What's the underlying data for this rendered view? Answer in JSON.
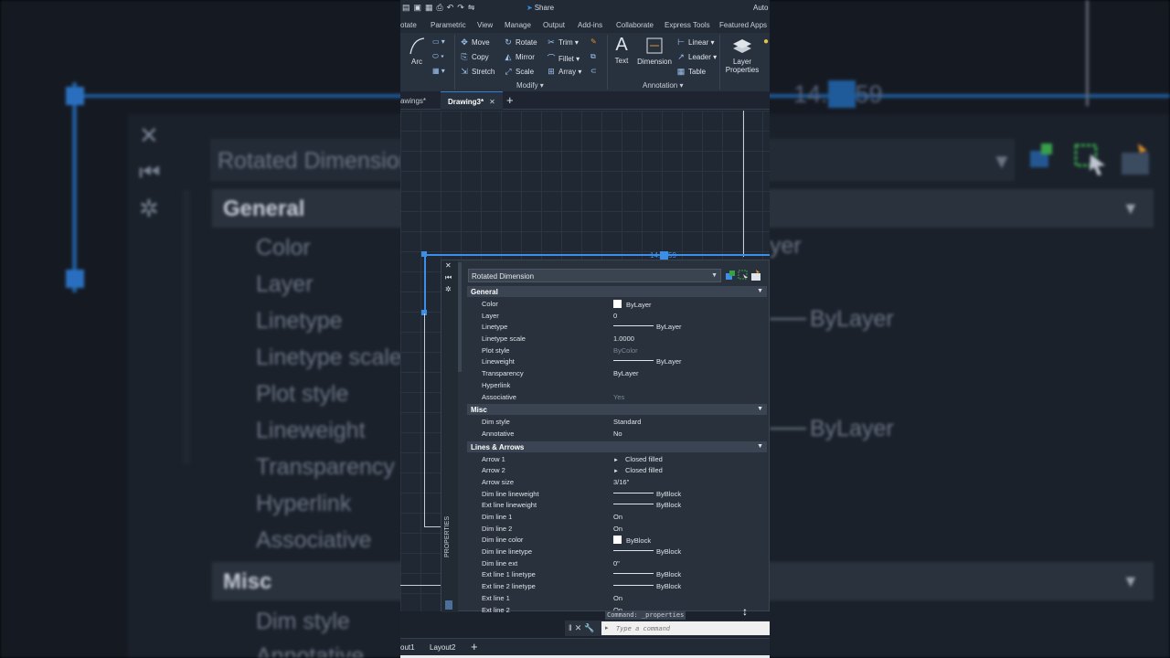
{
  "window": {
    "app_name": "Auto",
    "share_label": "Share"
  },
  "ribbon": {
    "tabs": [
      "otate",
      "Parametric",
      "View",
      "Manage",
      "Output",
      "Add-ins",
      "Collaborate",
      "Express Tools",
      "Featured Apps"
    ],
    "draw": {
      "arc_label": "Arc"
    },
    "modify": {
      "title": "Modify",
      "move": "Move",
      "rotate": "Rotate",
      "trim": "Trim",
      "copy": "Copy",
      "mirror": "Mirror",
      "fillet": "Fillet",
      "stretch": "Stretch",
      "scale": "Scale",
      "array": "Array"
    },
    "annotation": {
      "title": "Annotation",
      "text": "Text",
      "dimension": "Dimension",
      "linear": "Linear",
      "leader": "Leader",
      "table": "Table"
    },
    "layers": {
      "layer_properties_line1": "Layer",
      "layer_properties_line2": "Properties"
    }
  },
  "doc_tabs": {
    "prev": "awings*",
    "active": "Drawing3*"
  },
  "drawing": {
    "dimension_text_left": "14.",
    "dimension_text_right": "59"
  },
  "properties": {
    "palette_label": "PROPERTIES",
    "object_type": "Rotated Dimension",
    "sections": [
      {
        "title": "General",
        "rows": [
          {
            "key": "Color",
            "value": "ByLayer",
            "kind": "swatch"
          },
          {
            "key": "Layer",
            "value": "0",
            "kind": "text"
          },
          {
            "key": "Linetype",
            "value": "ByLayer",
            "kind": "line"
          },
          {
            "key": "Linetype scale",
            "value": "1.0000",
            "kind": "text"
          },
          {
            "key": "Plot style",
            "value": "ByColor",
            "kind": "dim"
          },
          {
            "key": "Lineweight",
            "value": "ByLayer",
            "kind": "line"
          },
          {
            "key": "Transparency",
            "value": "ByLayer",
            "kind": "text"
          },
          {
            "key": "Hyperlink",
            "value": "",
            "kind": "text"
          },
          {
            "key": "Associative",
            "value": "Yes",
            "kind": "dim"
          }
        ]
      },
      {
        "title": "Misc",
        "rows": [
          {
            "key": "Dim style",
            "value": "Standard",
            "kind": "text"
          },
          {
            "key": "Annotative",
            "value": "No",
            "kind": "text"
          }
        ]
      },
      {
        "title": "Lines & Arrows",
        "rows": [
          {
            "key": "Arrow 1",
            "value": "Closed filled",
            "kind": "arrow"
          },
          {
            "key": "Arrow 2",
            "value": "Closed filled",
            "kind": "arrow"
          },
          {
            "key": "Arrow size",
            "value": "3/16\"",
            "kind": "text"
          },
          {
            "key": "Dim line lineweight",
            "value": "ByBlock",
            "kind": "line"
          },
          {
            "key": "Ext line lineweight",
            "value": "ByBlock",
            "kind": "line"
          },
          {
            "key": "Dim line 1",
            "value": "On",
            "kind": "text"
          },
          {
            "key": "Dim line 2",
            "value": "On",
            "kind": "text"
          },
          {
            "key": "Dim line color",
            "value": "ByBlock",
            "kind": "swatch"
          },
          {
            "key": "Dim line linetype",
            "value": "ByBlock",
            "kind": "line"
          },
          {
            "key": "Dim line ext",
            "value": "0\"",
            "kind": "text"
          },
          {
            "key": "Ext line 1 linetype",
            "value": "ByBlock",
            "kind": "line"
          },
          {
            "key": "Ext line 2 linetype",
            "value": "ByBlock",
            "kind": "line"
          },
          {
            "key": "Ext line 1",
            "value": "On",
            "kind": "text"
          },
          {
            "key": "Ext line 2",
            "value": "On",
            "kind": "text"
          }
        ]
      }
    ]
  },
  "command": {
    "history": "Command: _properties",
    "placeholder": "Type a command"
  },
  "layout_tabs": {
    "first": "out1",
    "second": "Layout2"
  },
  "background": {
    "combo_text": "Rotated Dimension",
    "dim_text": "14.",
    "dim_text_end": "59",
    "sections": [
      "General",
      "Misc"
    ],
    "props": [
      "Color",
      "Layer",
      "Linetype",
      "Linetype scale",
      "Plot style",
      "Lineweight",
      "Transparency",
      "Hyperlink",
      "Associative",
      "Dim style",
      "Annotative"
    ],
    "values": [
      "yer",
      "ByLayer",
      "ByLayer"
    ]
  },
  "colors": {
    "accent": "#3d8ee8",
    "panel": "#28313c",
    "section": "#3b4453"
  }
}
